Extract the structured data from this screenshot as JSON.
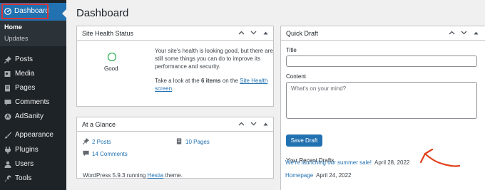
{
  "sidebar": {
    "dashboard_label": "Dashboard",
    "sub_items": [
      {
        "label": "Home"
      },
      {
        "label": "Updates"
      }
    ],
    "items": [
      {
        "label": "Posts",
        "icon": "pin-icon"
      },
      {
        "label": "Media",
        "icon": "media-icon"
      },
      {
        "label": "Pages",
        "icon": "pages-icon"
      },
      {
        "label": "Comments",
        "icon": "comments-icon"
      },
      {
        "label": "AdSanity",
        "icon": "adsanity-icon"
      },
      {
        "label": "Appearance",
        "icon": "brush-icon"
      },
      {
        "label": "Plugins",
        "icon": "plugin-icon"
      },
      {
        "label": "Users",
        "icon": "users-icon"
      },
      {
        "label": "Tools",
        "icon": "wrench-icon"
      }
    ]
  },
  "page": {
    "title": "Dashboard"
  },
  "site_health": {
    "title": "Site Health Status",
    "status": "Good",
    "text": "Your site's health is looking good, but there are still some things you can do to improve its performance and security.",
    "action_prefix": "Take a look at the ",
    "action_count": "6 items",
    "action_mid": " on the ",
    "action_link": "Site Health screen",
    "action_suffix": "."
  },
  "glance": {
    "title": "At a Glance",
    "posts": "2 Posts",
    "pages": "10 Pages",
    "comments": "14 Comments",
    "footer_prefix": "WordPress 5.9.3 running ",
    "footer_theme": "Hestia",
    "footer_suffix": " theme."
  },
  "quick_draft": {
    "title": "Quick Draft",
    "title_label": "Title",
    "title_value": "",
    "content_label": "Content",
    "content_placeholder": "What's on your mind?",
    "save_label": "Save Draft",
    "recent_heading": "Your Recent Drafts",
    "drafts": [
      {
        "title": "We're launching our summer sale!",
        "date": "April 28, 2022"
      },
      {
        "title": "Homepage",
        "date": "April 24, 2022"
      }
    ]
  },
  "colors": {
    "sidebar_bg": "#1d2327",
    "accent": "#2271b1",
    "highlight_outline": "#d63638",
    "health_good": "#00a32a",
    "annotation_arrow": "#e0401c"
  }
}
